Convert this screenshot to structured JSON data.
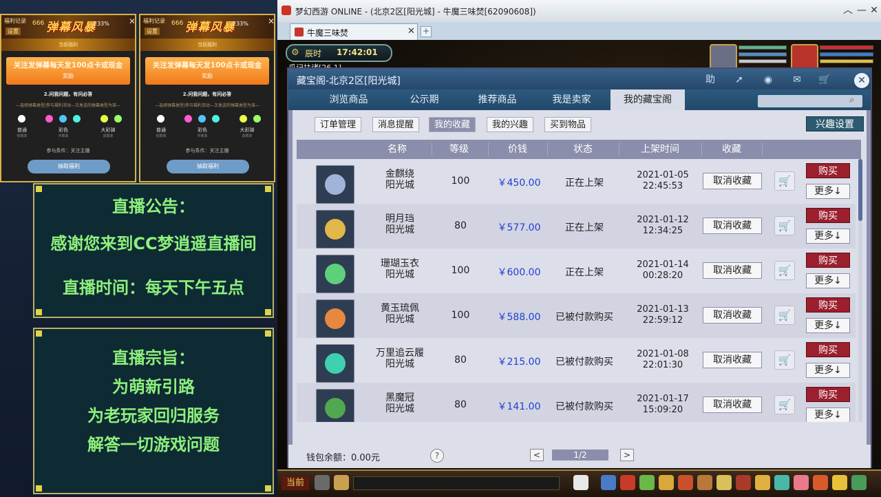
{
  "promo": {
    "tag_record": "福利记录",
    "tag_settings": "设置",
    "count": "666",
    "logo": "弹幕风暴",
    "percent": "233%",
    "close": "✕",
    "benefit_bar": "当前福利",
    "headline": "关注发弹幕每天发100点卡或现金",
    "headline_sub": "奖励",
    "line1": "2.问我问题，有问必答",
    "line2": "—选择弹幕类型|参与福利活动—次发送的弹幕类型为准—",
    "dots": [
      {
        "color": "#ffffff",
        "label": "普通",
        "sub": "低概率"
      },
      {
        "color": "#ff5ad0",
        "label": "彩色",
        "sub": "中概率"
      },
      {
        "color": "#d9ff3a",
        "label": "大彩弹",
        "sub": "高概率"
      }
    ],
    "dot_extra_colors": [
      "#ff5ad0",
      "#4fc6ff",
      "#4ef0e0",
      "#e8ff44",
      "#9aff66"
    ],
    "condition": "参与条件：关注主播",
    "button": "抽取福利"
  },
  "announcement": {
    "title": "直播公告：",
    "line1": "感谢您来到CC梦逍遥直播间",
    "line2": "直播时间：每天下午五点"
  },
  "purpose": {
    "title": "直播宗旨：",
    "lines": [
      "为萌新引路",
      "为老玩家回归服务",
      "解答一切游戏问题"
    ]
  },
  "window": {
    "title": "梦幻西游 ONLINE - (北京2区[阳光城] - 牛魔三味焚[62090608])",
    "tab": "牛魔三味焚",
    "tab_close": "✕",
    "plus": "+",
    "min": "︿",
    "minimize": "—",
    "close": "✕"
  },
  "hud": {
    "clock_label": "辰时",
    "clock_time": "17:42:01",
    "bg_text": "瓜记扶诸[26,1]"
  },
  "dialog": {
    "title": "藏宝阁-北京2区[阳光城]",
    "help": "助",
    "close": "✕",
    "main_tabs": [
      {
        "label": "浏览商品",
        "active": false
      },
      {
        "label": "公示期",
        "active": false
      },
      {
        "label": "推荐商品",
        "active": false
      },
      {
        "label": "我是卖家",
        "active": false
      },
      {
        "label": "我的藏宝阁",
        "active": true
      }
    ],
    "sub_tabs": [
      {
        "label": "订单管理",
        "active": false
      },
      {
        "label": "消息提醒",
        "active": false
      },
      {
        "label": "我的收藏",
        "active": true
      },
      {
        "label": "我的兴趣",
        "active": false
      },
      {
        "label": "买到物品",
        "active": false
      }
    ],
    "interest_button": "兴趣设置",
    "columns": [
      "名称",
      "等级",
      "价钱",
      "状态",
      "上架时间",
      "收藏"
    ],
    "rows": [
      {
        "name": "金麒绕",
        "server": "阳光城",
        "level": "100",
        "price": "￥450.00",
        "status": "正在上架",
        "date": "2021-01-05",
        "time": "22:45:53",
        "color": "#9fb4d8"
      },
      {
        "name": "明月珰",
        "server": "阳光城",
        "level": "80",
        "price": "￥577.00",
        "status": "正在上架",
        "date": "2021-01-12",
        "time": "12:34:25",
        "color": "#e2b84a"
      },
      {
        "name": "珊瑚玉衣",
        "server": "阳光城",
        "level": "100",
        "price": "￥600.00",
        "status": "正在上架",
        "date": "2021-01-14",
        "time": "00:28:20",
        "color": "#5ed07a"
      },
      {
        "name": "黄玉琉佩",
        "server": "阳光城",
        "level": "100",
        "price": "￥588.00",
        "status": "已被付款购买",
        "date": "2021-01-13",
        "time": "22:59:12",
        "color": "#e88840"
      },
      {
        "name": "万里追云履",
        "server": "阳光城",
        "level": "80",
        "price": "￥215.00",
        "status": "已被付款购买",
        "date": "2021-01-08",
        "time": "22:01:30",
        "color": "#3fd0b0"
      },
      {
        "name": "黑魔冠",
        "server": "阳光城",
        "level": "80",
        "price": "￥141.00",
        "status": "已被付款购买",
        "date": "2021-01-17",
        "time": "15:09:20",
        "color": "#52a850"
      }
    ],
    "unfav_label": "取消收藏",
    "buy_label": "购买",
    "more_label": "更多↓",
    "cart_icon": "🛒",
    "balance": "钱包余额：0.00元",
    "help_icon": "?",
    "prev": "<",
    "page": "1/2",
    "next": ">"
  },
  "bottom": {
    "current_label": "当前"
  }
}
